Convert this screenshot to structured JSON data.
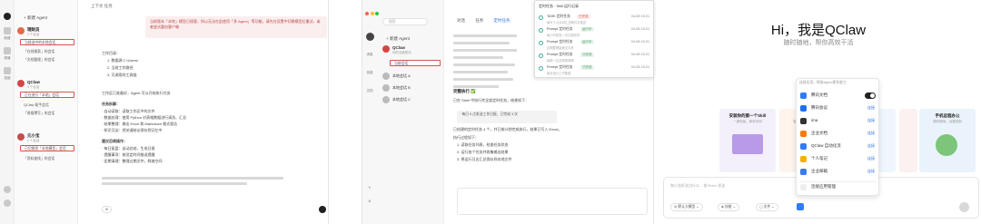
{
  "panel1": {
    "rail": [
      "新建",
      "频道",
      "技能",
      "设置"
    ],
    "new_agent_label": "+ 新建 Agent",
    "topbar": "上下文   任务",
    "banner": "当前版本「本地」模型已接管，所以无法在此使用「多 Agent」等功能，请先在设置中切换模型后重试，或者尝试重启客户端",
    "agents": [
      {
        "name": "理财员",
        "sub": "2 个会话",
        "sessions": [
          "当前选中的本地会话",
          "「在线搜索」的会话",
          "「文档整理」的会话"
        ],
        "color": "#e26b4a"
      },
      {
        "name": "QClaw",
        "sub": "3 个会话",
        "sessions": [
          "正在进行「本地」会话",
          "QClaw 助手会话",
          "「周报撰写」的会话"
        ],
        "color": "#d64545"
      },
      {
        "name": "元小宝",
        "sub": "2 个会话",
        "sessions": [
          "已切换到「本地模型」会话",
          "「资料查找」的会话"
        ],
        "color": "#c94b4b"
      }
    ],
    "content_lines": [
      "工作目录：",
      "1. 数据源 C:\\Users\\",
      "2. 当前工作路径",
      "3. 可调用的工具链",
      "工作区已准备好，Agent 可以开始执行任务",
      "任务拆解：",
      "· 自动读取：读取工作区中的文件",
      "· 数据处理：使用 Python 对表格数据进行清洗、汇总",
      "· 结果整理：输出 Excel 和 Markdown 格式报告",
      "· 知识沉淀：把关键结论保存到记忆中",
      "建议后续操作：",
      "· 每日复盘：自动总结，生成日报",
      "· 提醒事项：按设定时间推送提醒",
      "· 定期清理：整理过期文件，释放空间"
    ]
  },
  "panel2": {
    "search_placeholder": "搜索",
    "rail": [
      "消息",
      "技能",
      "文档"
    ],
    "new_agent_label": "+ 新建 Agent",
    "agents": [
      {
        "name": "QClaw",
        "sub": "你的全能助手"
      },
      {
        "name": "本地会话 A",
        "sub": "1 个会话"
      },
      {
        "name": "本地会话 B",
        "sub": "1 个会话"
      },
      {
        "name": "本地会话 C",
        "sub": "1 个会话"
      }
    ],
    "tabs": [
      "对话",
      "任务",
      "定时任务"
    ],
    "content_title": "完整执行 ✅",
    "content_lines": [
      "已在 Shell 中执行完全部定时任务，结果如下：",
      "· 每日 9 点发送工作日报，已完成 3 次",
      "已创建的定时任务 4 个，并已按计划完成执行，结果已写入 Excel。",
      "执行过程如下：",
      "1. 读取任务列表，检查任务状态",
      "2. 运行各个任务并收集输出结果",
      "3. 将运行日志汇总保存到本地文件"
    ],
    "popup": {
      "title": "定时任务 · Skill 运行记录",
      "rows": [
        {
          "title": "TASK 定时任务",
          "tag": "已完成",
          "time": "04-08 15:21",
          "desc": "每天 9 点自动汇总邮件并推送"
        },
        {
          "title": "Prompt 定时任务",
          "tag": "运行中",
          "time": "04-08 15:21",
          "desc": "每小时检查一次日程安排"
        },
        {
          "title": "Prompt 定时任务",
          "tag": "运行中",
          "time": "04-08 15:21",
          "desc": "定期整理桌面文件夹"
        },
        {
          "title": "Prompt 定时任务",
          "tag": "已完成",
          "time": "04-08 15:21",
          "desc": "每周一生成周报草稿"
        },
        {
          "title": "Prompt 定时任务",
          "tag": "已完成",
          "time": "04-08 15:21",
          "desc": "每月统计工作数据"
        }
      ]
    }
  },
  "panel3": {
    "title": "Hi，我是QClaw",
    "subtitle": "随时随地，帮你高效干活",
    "cards": [
      {
        "title": "安装你的第一个Skill",
        "sub": "一键安装，即刻可用"
      },
      {
        "title": "邮件管理",
        "sub": "智能分类，自动回复"
      },
      {
        "title": "",
        "sub": ""
      },
      {
        "title": "",
        "sub": ""
      },
      {
        "title": "手机远程办公",
        "sub": "随时随地，远程控制"
      }
    ],
    "input_placeholder": "和小龙虾说点什么... 按 Enter 发送",
    "chips": [
      "默认大模型",
      "技能",
      "文件"
    ],
    "menu": {
      "hint": "连接应用，释放Agent更多能力",
      "items": [
        {
          "label": "腾讯文档",
          "action": "toggle",
          "color": "#2f7cf6"
        },
        {
          "label": "腾讯会议",
          "action": "连接",
          "color": "#1d6ff2"
        },
        {
          "label": "ima",
          "action": "连接",
          "color": "#333333"
        },
        {
          "label": "企业文档",
          "action": "连接",
          "color": "#ff7a00"
        },
        {
          "label": "QClaw 自动化流",
          "action": "连接",
          "color": "#2f7cf6"
        },
        {
          "label": "个人笔记",
          "action": "连接",
          "color": "#f3b200"
        },
        {
          "label": "企业邮箱",
          "action": "连接",
          "color": "#3b7be9"
        }
      ],
      "footer": "连接应用管理"
    }
  }
}
